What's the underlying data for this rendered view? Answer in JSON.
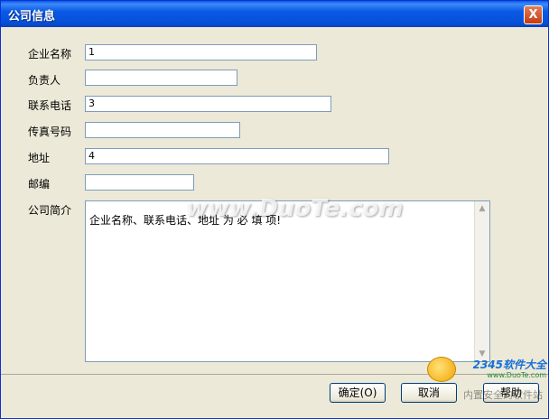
{
  "window": {
    "title": "公司信息",
    "close_label": "X"
  },
  "form": {
    "company_name": {
      "label": "企业名称",
      "value": "1"
    },
    "responsible_person": {
      "label": "负责人",
      "value": ""
    },
    "contact_phone": {
      "label": "联系电话",
      "value": "3"
    },
    "fax_number": {
      "label": "传真号码",
      "value": ""
    },
    "address": {
      "label": "地址",
      "value": "4"
    },
    "postal_code": {
      "label": "邮编",
      "value": ""
    },
    "company_profile": {
      "label": "公司简介",
      "value": "企业名称、联系电话、地址 为 必 填 项!"
    }
  },
  "buttons": {
    "ok": "确定(O)",
    "cancel": "取消",
    "help": "帮助"
  },
  "watermarks": {
    "center": "www.DuoTe.com",
    "logo_main": "2345软件大全",
    "logo_sub": "www.DuoTe.com",
    "logo_bottom": "内置安全的软件站"
  },
  "colors": {
    "title_bar": "#0a5ae6",
    "window_bg": "#ece9d8",
    "field_border": "#7f9db9",
    "close_button": "#c53b11"
  }
}
